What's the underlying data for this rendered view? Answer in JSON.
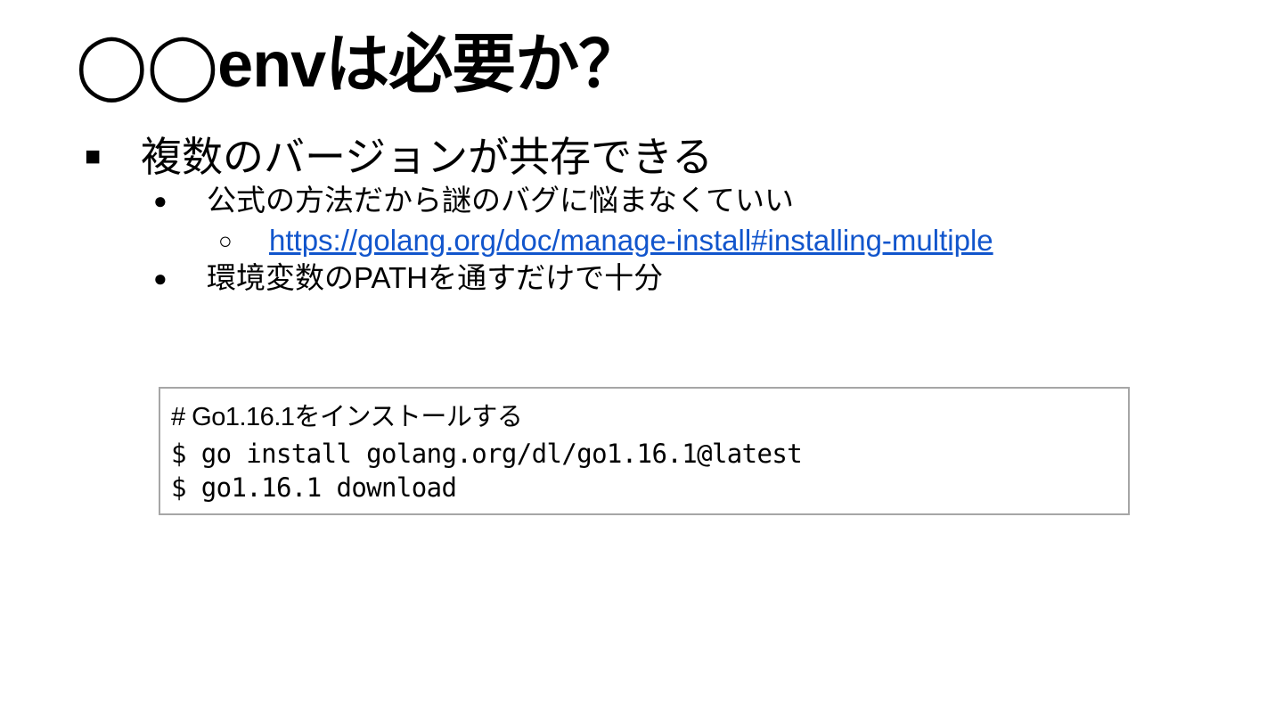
{
  "slide": {
    "title": "◯◯envは必要か？",
    "bullets": [
      {
        "marker": "■",
        "text": "複数のバージョンが共存できる"
      },
      {
        "marker": "●",
        "text": "公式の方法だから謎のバグに悩まなくていい"
      },
      {
        "marker": "○",
        "text": "https://golang.org/doc/manage-install#installing-multiple"
      },
      {
        "marker": "●",
        "text": "環境変数のPATHを通すだけで十分"
      }
    ],
    "code": {
      "comment": "# Go1.16.1をインストールする",
      "lines": [
        "$ go install golang.org/dl/go1.16.1@latest",
        "$ go1.16.1 download"
      ]
    },
    "colors": {
      "link": "#1155cc",
      "code_border": "#a6a6a6",
      "text": "#000000",
      "background": "#ffffff"
    }
  }
}
